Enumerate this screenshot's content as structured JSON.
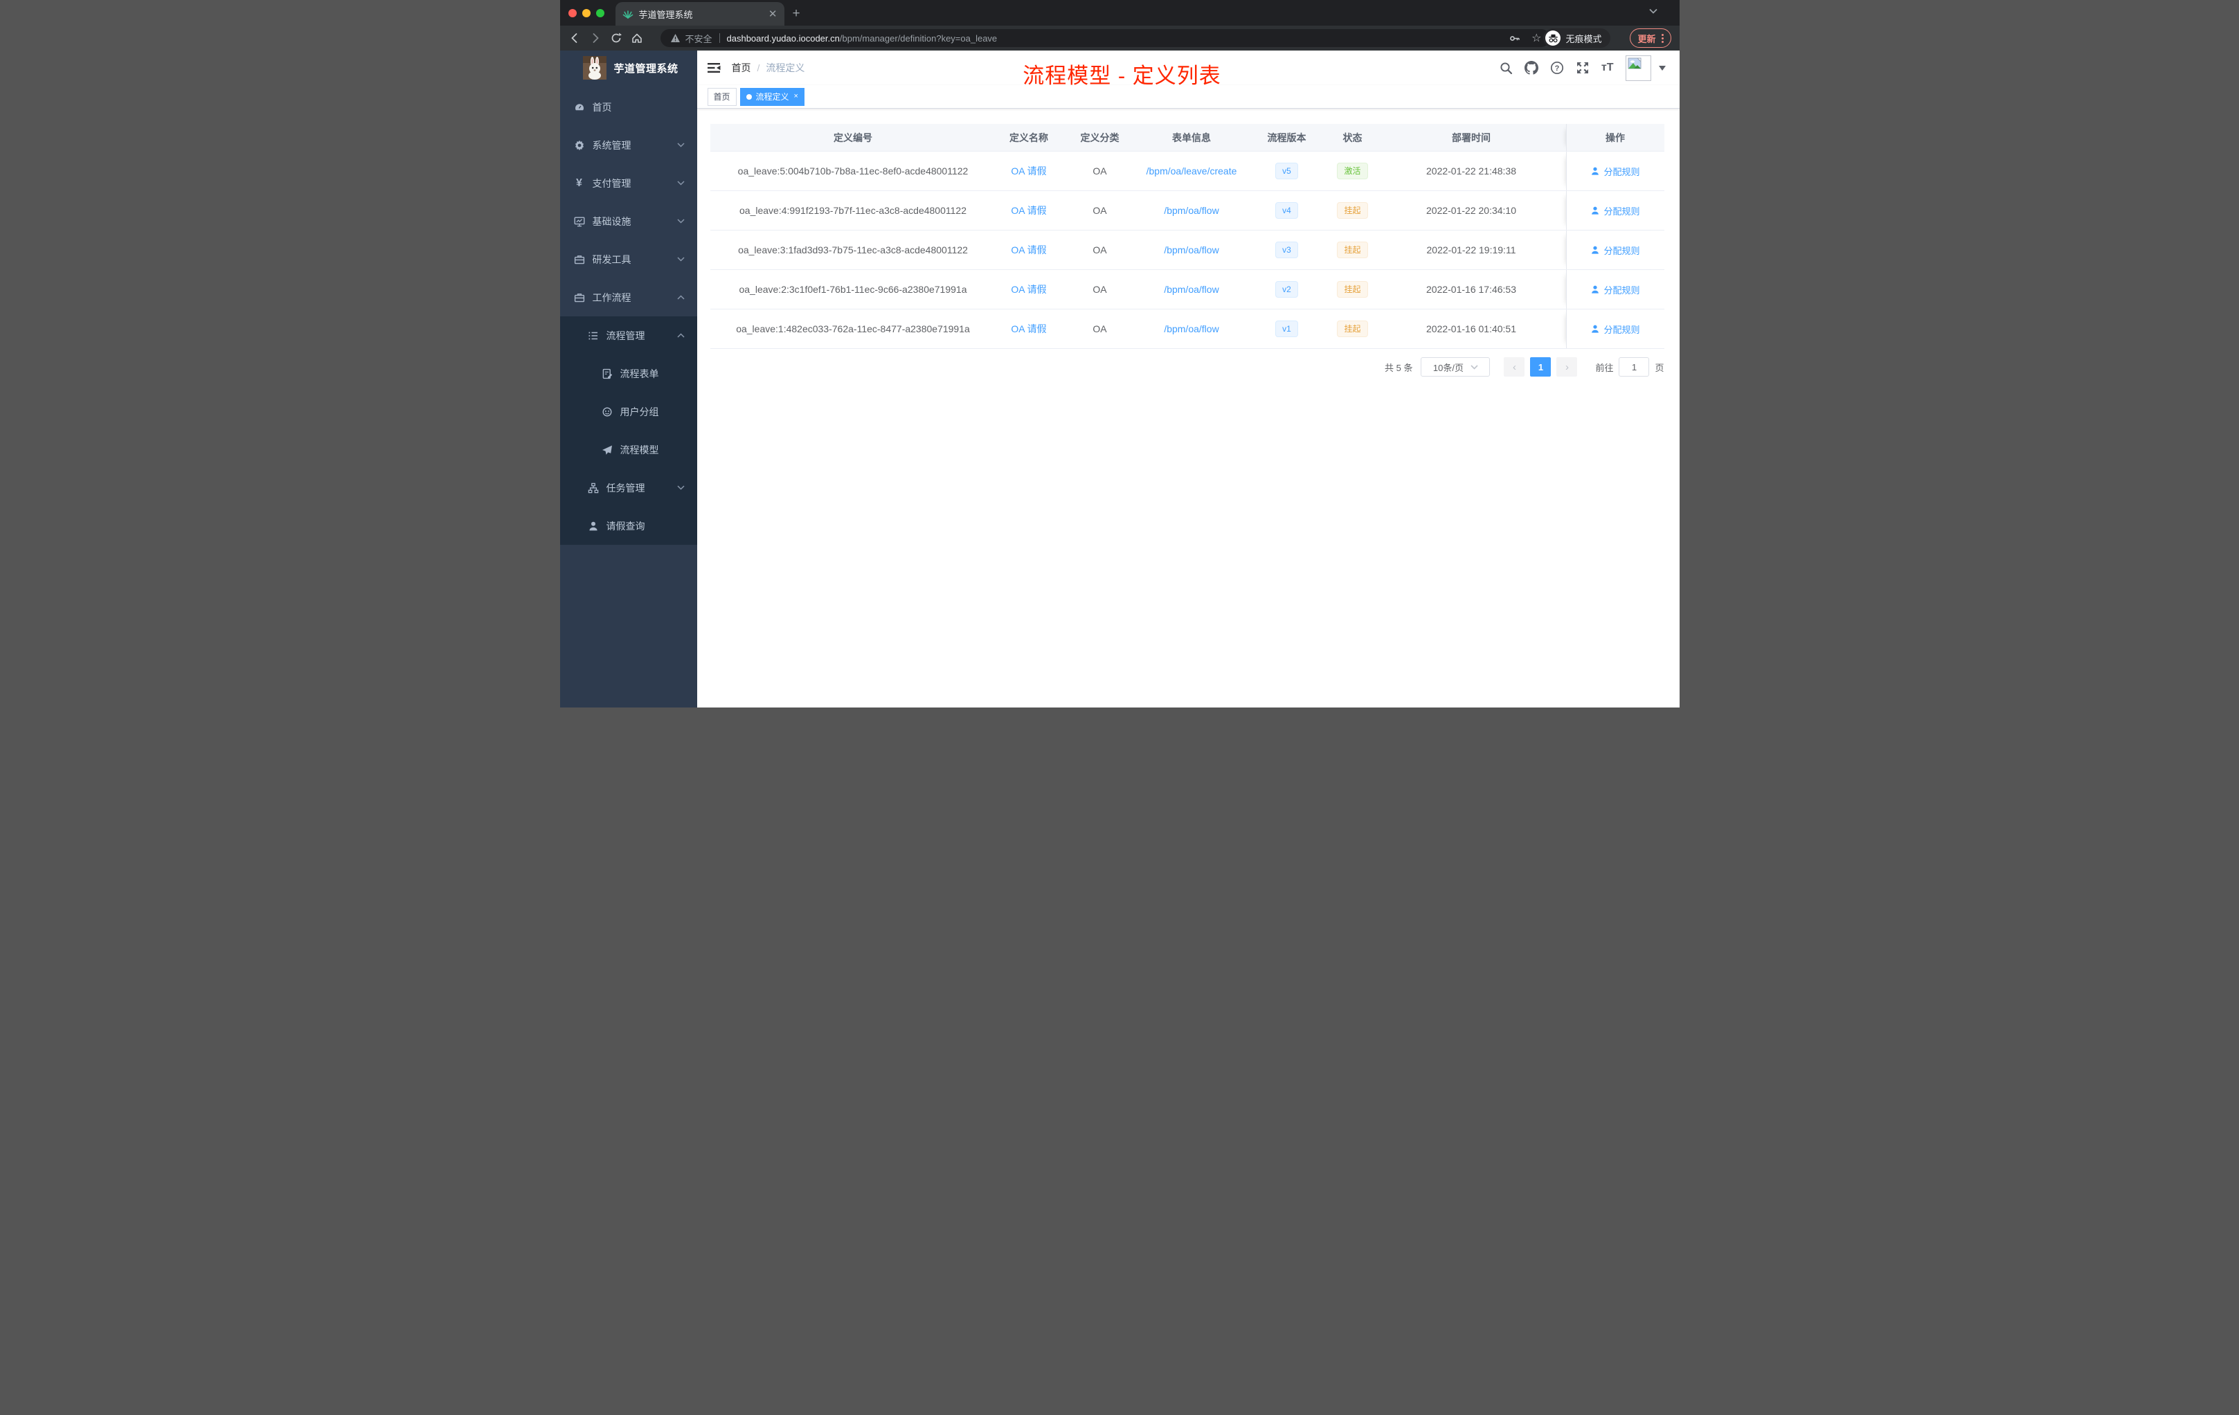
{
  "browser": {
    "tab_title": "芋道管理系统",
    "security_label": "不安全",
    "url_host": "dashboard.yudao.iocoder.cn",
    "url_path": "/bpm/manager/definition?key=oa_leave",
    "incognito_label": "无痕模式",
    "update_label": "更新"
  },
  "sidebar": {
    "logo_title": "芋道管理系统",
    "items": [
      {
        "label": "首页",
        "icon": "dashboard-icon",
        "level": 1,
        "arrow": null,
        "sub": false
      },
      {
        "label": "系统管理",
        "icon": "gear-icon",
        "level": 1,
        "arrow": "down",
        "sub": false
      },
      {
        "label": "支付管理",
        "icon": "yen-icon",
        "level": 1,
        "arrow": "down",
        "sub": false
      },
      {
        "label": "基础设施",
        "icon": "monitor-icon",
        "level": 1,
        "arrow": "down",
        "sub": false
      },
      {
        "label": "研发工具",
        "icon": "toolbox-icon",
        "level": 1,
        "arrow": "down",
        "sub": false
      },
      {
        "label": "工作流程",
        "icon": "briefcase-icon",
        "level": 1,
        "arrow": "up",
        "sub": false
      },
      {
        "label": "流程管理",
        "icon": "list-icon",
        "level": 2,
        "arrow": "up",
        "sub": true
      },
      {
        "label": "流程表单",
        "icon": "form-icon",
        "level": 3,
        "arrow": null,
        "sub": true
      },
      {
        "label": "用户分组",
        "icon": "usergroup-icon",
        "level": 3,
        "arrow": null,
        "sub": true
      },
      {
        "label": "流程模型",
        "icon": "send-icon",
        "level": 3,
        "arrow": null,
        "sub": true
      },
      {
        "label": "任务管理",
        "icon": "tree-icon",
        "level": 2,
        "arrow": "down",
        "sub": true
      },
      {
        "label": "请假查询",
        "icon": "user-icon",
        "level": 2,
        "arrow": null,
        "sub": true
      }
    ]
  },
  "navbar": {
    "breadcrumb_home": "首页",
    "breadcrumb_sep": "/",
    "breadcrumb_current": "流程定义",
    "annotation_title": "流程模型 - 定义列表"
  },
  "tags": {
    "home_label": "首页",
    "active_label": "流程定义",
    "close_glyph": "×"
  },
  "table": {
    "columns": [
      "定义编号",
      "定义名称",
      "定义分类",
      "表单信息",
      "流程版本",
      "状态",
      "部署时间",
      "操作"
    ],
    "rows": [
      {
        "id": "oa_leave:5:004b710b-7b8a-11ec-8ef0-acde48001122",
        "name": "OA 请假",
        "category": "OA",
        "form": "/bpm/oa/leave/create",
        "version": "v5",
        "status": "激活",
        "status_type": "success",
        "time": "2022-01-22 21:48:38",
        "action": "分配规则"
      },
      {
        "id": "oa_leave:4:991f2193-7b7f-11ec-a3c8-acde48001122",
        "name": "OA 请假",
        "category": "OA",
        "form": "/bpm/oa/flow",
        "version": "v4",
        "status": "挂起",
        "status_type": "warning",
        "time": "2022-01-22 20:34:10",
        "action": "分配规则"
      },
      {
        "id": "oa_leave:3:1fad3d93-7b75-11ec-a3c8-acde48001122",
        "name": "OA 请假",
        "category": "OA",
        "form": "/bpm/oa/flow",
        "version": "v3",
        "status": "挂起",
        "status_type": "warning",
        "time": "2022-01-22 19:19:11",
        "action": "分配规则"
      },
      {
        "id": "oa_leave:2:3c1f0ef1-76b1-11ec-9c66-a2380e71991a",
        "name": "OA 请假",
        "category": "OA",
        "form": "/bpm/oa/flow",
        "version": "v2",
        "status": "挂起",
        "status_type": "warning",
        "time": "2022-01-16 17:46:53",
        "action": "分配规则"
      },
      {
        "id": "oa_leave:1:482ec033-762a-11ec-8477-a2380e71991a",
        "name": "OA 请假",
        "category": "OA",
        "form": "/bpm/oa/flow",
        "version": "v1",
        "status": "挂起",
        "status_type": "warning",
        "time": "2022-01-16 01:40:51",
        "action": "分配规则"
      }
    ]
  },
  "pagination": {
    "total_label": "共 5 条",
    "page_size": "10条/页",
    "current_page": "1",
    "goto_label": "前往",
    "goto_value": "1",
    "page_unit": "页"
  },
  "colors": {
    "accent": "#409eff",
    "annotation_red": "#ff2600",
    "sidebar_bg": "#2e3b4e",
    "submenu_bg": "#1f2d3d",
    "success_text": "#67c23a",
    "success_bg": "#f0f9eb",
    "warning_text": "#e6a23c",
    "warning_bg": "#fdf6ec",
    "version_text": "#409eff",
    "version_bg": "#ecf5ff",
    "update_button": "#f28b82",
    "traffic_red": "#ff5f57",
    "traffic_yellow": "#febc2e",
    "traffic_green": "#28c840"
  }
}
